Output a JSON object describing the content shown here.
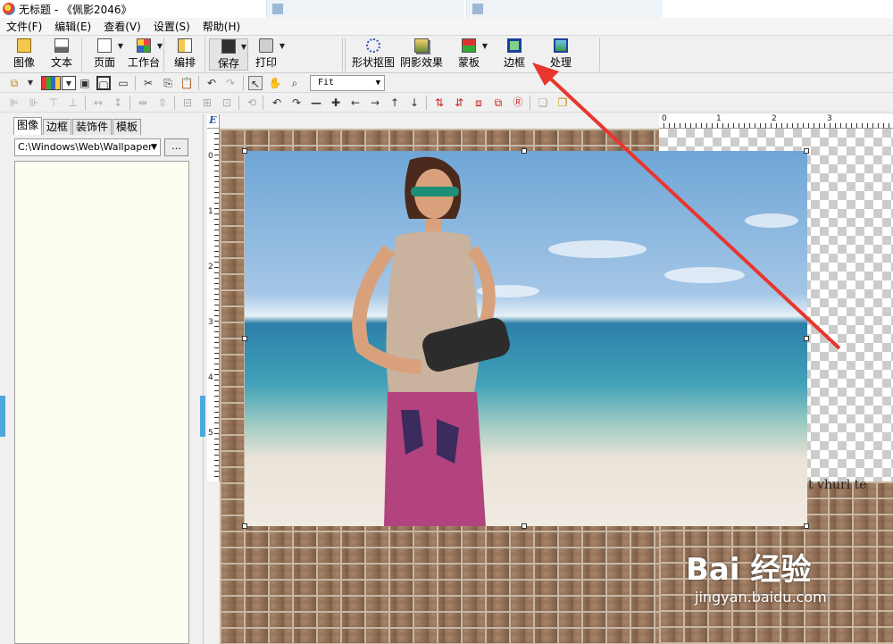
{
  "window": {
    "title": "无标题 - 《佩影2046》"
  },
  "menu": [
    "文件(F)",
    "编辑(E)",
    "查看(V)",
    "设置(S)",
    "帮助(H)"
  ],
  "toolbar_big": {
    "image": "图像",
    "text": "文本",
    "page": "页面",
    "workbench": "工作台",
    "layout": "编排",
    "save": "保存",
    "print": "打印",
    "shape_crop": "形状抠图",
    "shadow": "阴影效果",
    "mask": "蒙板",
    "frame": "边框",
    "process": "处理"
  },
  "zoom": {
    "value": "Fit"
  },
  "panel": {
    "tabs": [
      "图像",
      "边框",
      "装饰件",
      "模板"
    ],
    "path": "C:\\Windows\\Web\\Wallpaper",
    "browse_label": "..."
  },
  "ruler": {
    "corner": "E",
    "h_ticks": [
      "0",
      "1",
      "2",
      "3"
    ],
    "v_ticks": [
      "0",
      "1",
      "2",
      "3",
      "4",
      "5"
    ]
  },
  "canvas": {
    "partial_text": "t vhurl te"
  },
  "watermark": {
    "logo": "Bai 经验",
    "url": "jingyan.baidu.com"
  },
  "colors": {
    "arrow": "#e8362e",
    "panel_bg": "#fdfdf1",
    "accent_handle": "#4ea8dc"
  }
}
